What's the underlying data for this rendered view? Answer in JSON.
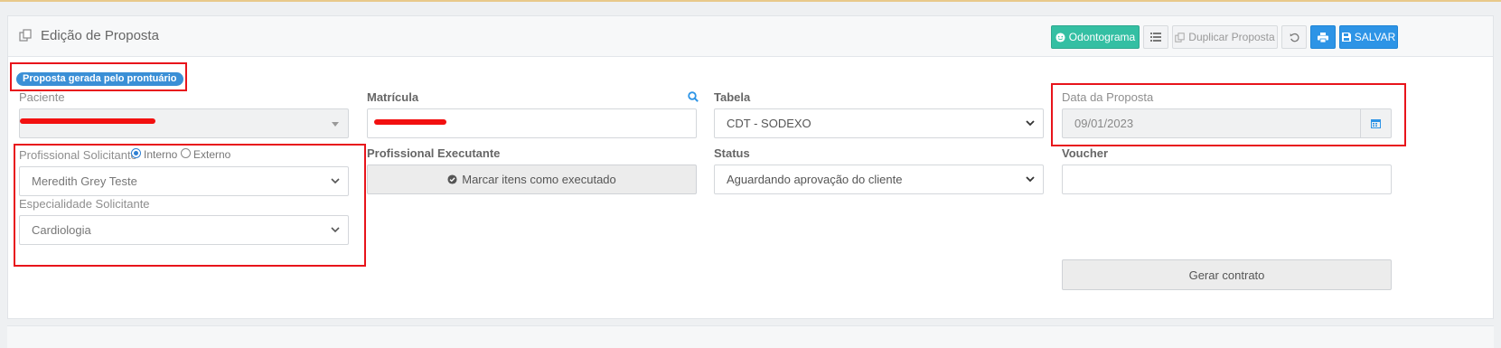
{
  "header": {
    "title": "Edição de Proposta",
    "buttons": {
      "odontograma": "Odontograma",
      "duplicar": "Duplicar Proposta",
      "salvar": "SALVAR"
    }
  },
  "badge": "Proposta gerada pelo prontuário",
  "paciente": {
    "label": "Paciente",
    "value": ""
  },
  "matricula": {
    "label": "Matrícula",
    "value": ""
  },
  "tabela": {
    "label": "Tabela",
    "value": "CDT - SODEXO"
  },
  "data_proposta": {
    "label": "Data da Proposta",
    "value": "09/01/2023"
  },
  "profissional_solicitante": {
    "label": "Profissional Solicitante",
    "interno": "Interno",
    "externo": "Externo",
    "selected": "Interno",
    "value": "Meredith Grey Teste"
  },
  "especialidade": {
    "label": "Especialidade Solicitante",
    "value": "Cardiologia"
  },
  "profissional_executante": {
    "label": "Profissional Executante",
    "button": "Marcar itens como executado"
  },
  "status": {
    "label": "Status",
    "value": "Aguardando aprovação do cliente"
  },
  "voucher": {
    "label": "Voucher",
    "value": ""
  },
  "gerar_contrato": "Gerar contrato",
  "colors": {
    "accent_green": "#34bfa3",
    "primary_blue": "#2d94e6",
    "badge_blue": "#3a8fd6",
    "highlight_red": "#e8141b"
  }
}
